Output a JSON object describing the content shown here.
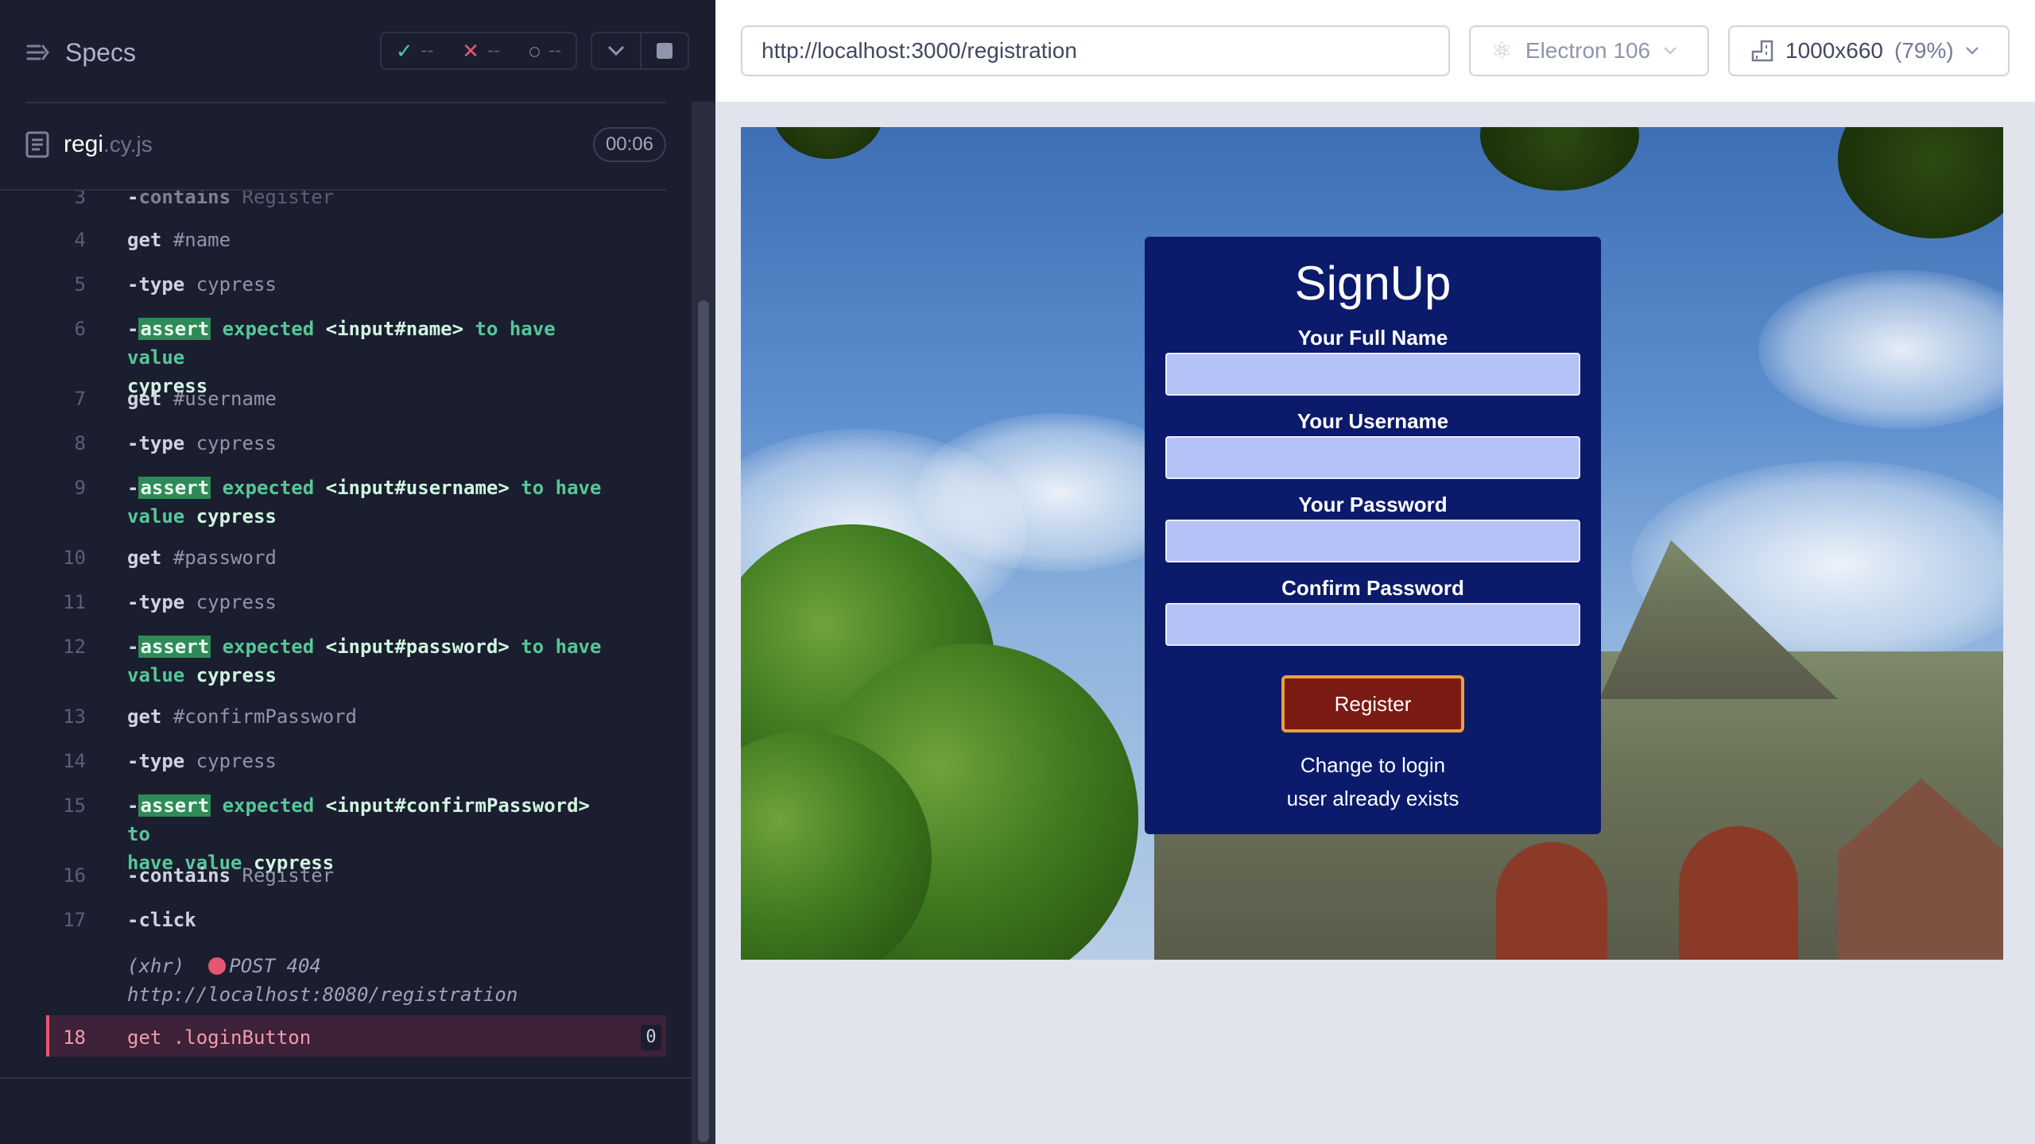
{
  "reporter": {
    "title": "Specs",
    "stats": {
      "passed": "--",
      "failed": "--",
      "pending": "--"
    },
    "file": {
      "name": "regi",
      "ext": ".cy.js",
      "duration": "00:06"
    },
    "commands": [
      {
        "num": "3",
        "dash": "-",
        "name": "contains",
        "arg": "Register"
      },
      {
        "num": "4",
        "name": "get",
        "arg": "#name"
      },
      {
        "num": "5",
        "dash": "-",
        "name": "type",
        "arg": "cypress"
      },
      {
        "num": "6",
        "dash": "-",
        "badge": "assert",
        "text1": "expected",
        "el": "<input#name>",
        "text2": "to have value",
        "val": "cypress"
      },
      {
        "num": "7",
        "name": "get",
        "arg": "#username"
      },
      {
        "num": "8",
        "dash": "-",
        "name": "type",
        "arg": "cypress"
      },
      {
        "num": "9",
        "dash": "-",
        "badge": "assert",
        "text1": "expected",
        "el": "<input#username>",
        "text2": "to have",
        "text3": "value",
        "val": "cypress"
      },
      {
        "num": "10",
        "name": "get",
        "arg": "#password"
      },
      {
        "num": "11",
        "dash": "-",
        "name": "type",
        "arg": "cypress"
      },
      {
        "num": "12",
        "dash": "-",
        "badge": "assert",
        "text1": "expected",
        "el": "<input#password>",
        "text2": "to have",
        "text3": "value",
        "val": "cypress"
      },
      {
        "num": "13",
        "name": "get",
        "arg": "#confirmPassword"
      },
      {
        "num": "14",
        "dash": "-",
        "name": "type",
        "arg": "cypress"
      },
      {
        "num": "15",
        "dash": "-",
        "badge": "assert",
        "text1": "expected",
        "el": "<input#confirmPassword>",
        "text2": "to",
        "text3": "have value",
        "val": "cypress"
      },
      {
        "num": "16",
        "dash": "-",
        "name": "contains",
        "arg": "Register"
      },
      {
        "num": "17",
        "dash": "-",
        "name": "click",
        "arg": ""
      }
    ],
    "xhr": {
      "label": "(xhr)",
      "method": "POST 404",
      "url": "http://localhost:8080/registration"
    },
    "failed": {
      "num": "18",
      "name": "get",
      "arg": ".loginButton",
      "count": "0"
    }
  },
  "browser": {
    "url": "http://localhost:3000/registration",
    "name": "Electron 106",
    "viewport": "1000x660",
    "zoom": "(79%)"
  },
  "app": {
    "title": "SignUp",
    "fields": [
      "Your Full Name",
      "Your Username",
      "Your Password",
      "Confirm Password"
    ],
    "button": "Register",
    "link": "Change to login",
    "error": "user already exists"
  },
  "colors": {
    "passed": "#56c79a",
    "failed": "#e45770",
    "form_bg": "#0b1a6b",
    "button_bg": "#7a1a12"
  }
}
